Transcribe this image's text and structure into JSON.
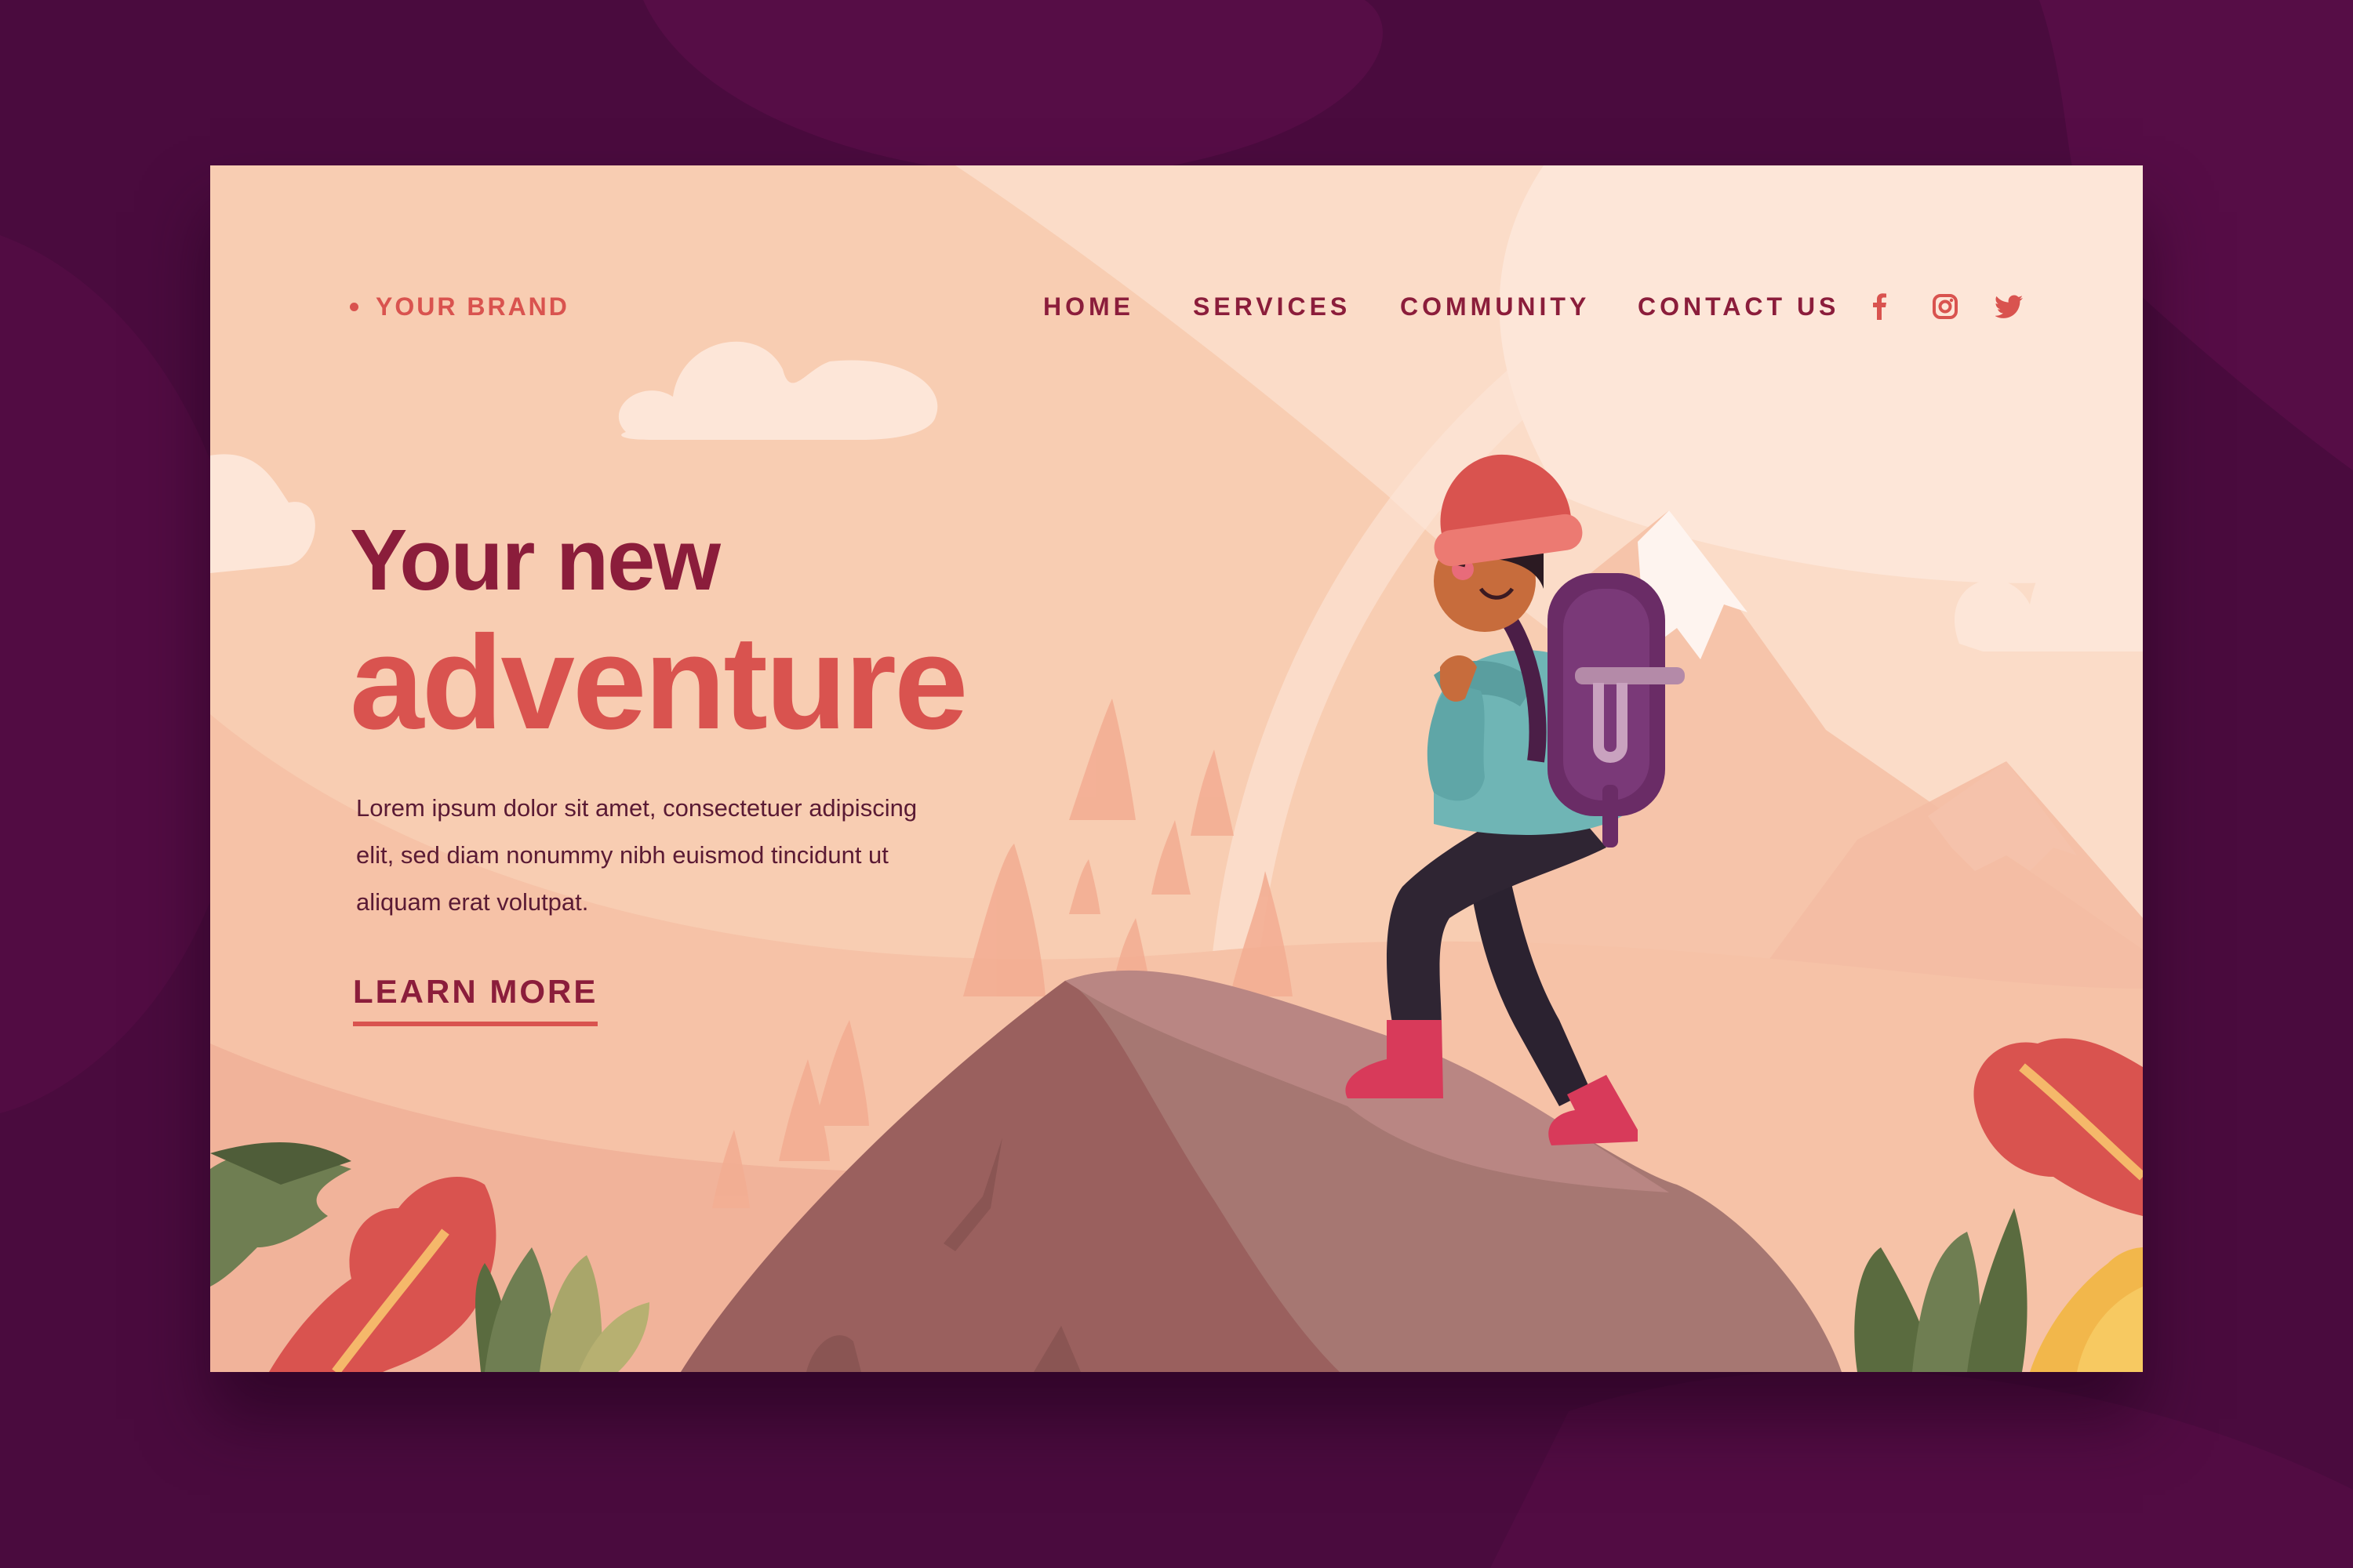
{
  "brand": {
    "name": "YOUR BRAND"
  },
  "nav": {
    "items": [
      {
        "label": "HOME"
      },
      {
        "label": "SERVICES"
      },
      {
        "label": "COMMUNITY"
      },
      {
        "label": "CONTACT US"
      }
    ]
  },
  "social": {
    "icons": [
      "facebook-icon",
      "instagram-icon",
      "twitter-icon"
    ]
  },
  "hero": {
    "title_line1": "Your new",
    "title_line2": "adventure",
    "body": "Lorem ipsum dolor sit amet, consectetuer adipiscing elit, sed diam nonummy nibh euismod tincidunt ut aliquam erat volutpat.",
    "cta_label": "LEARN MORE"
  },
  "colors": {
    "page_background": "#4a0b3e",
    "card_background": "#f8cdb2",
    "primary_dark": "#8b1d3b",
    "accent": "#d9534f",
    "body_text": "#5a1a34"
  }
}
